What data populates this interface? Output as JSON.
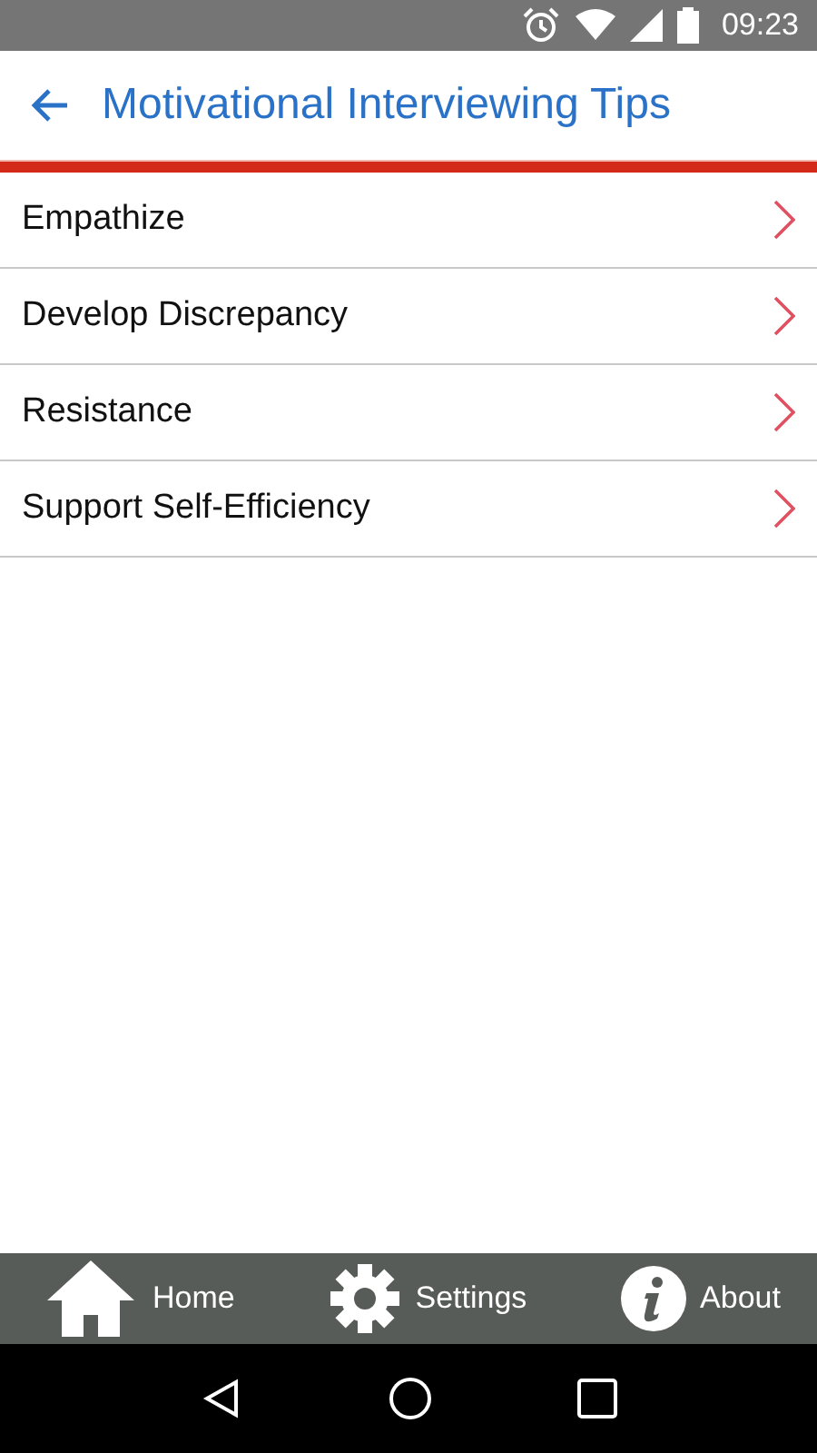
{
  "status_bar": {
    "time": "09:23"
  },
  "app_bar": {
    "title": "Motivational Interviewing Tips"
  },
  "items": [
    {
      "label": "Empathize"
    },
    {
      "label": "Develop Discrepancy"
    },
    {
      "label": "Resistance"
    },
    {
      "label": "Support Self-Efficiency"
    }
  ],
  "bottom_nav": [
    {
      "label": "Home"
    },
    {
      "label": "Settings"
    },
    {
      "label": "About"
    }
  ]
}
